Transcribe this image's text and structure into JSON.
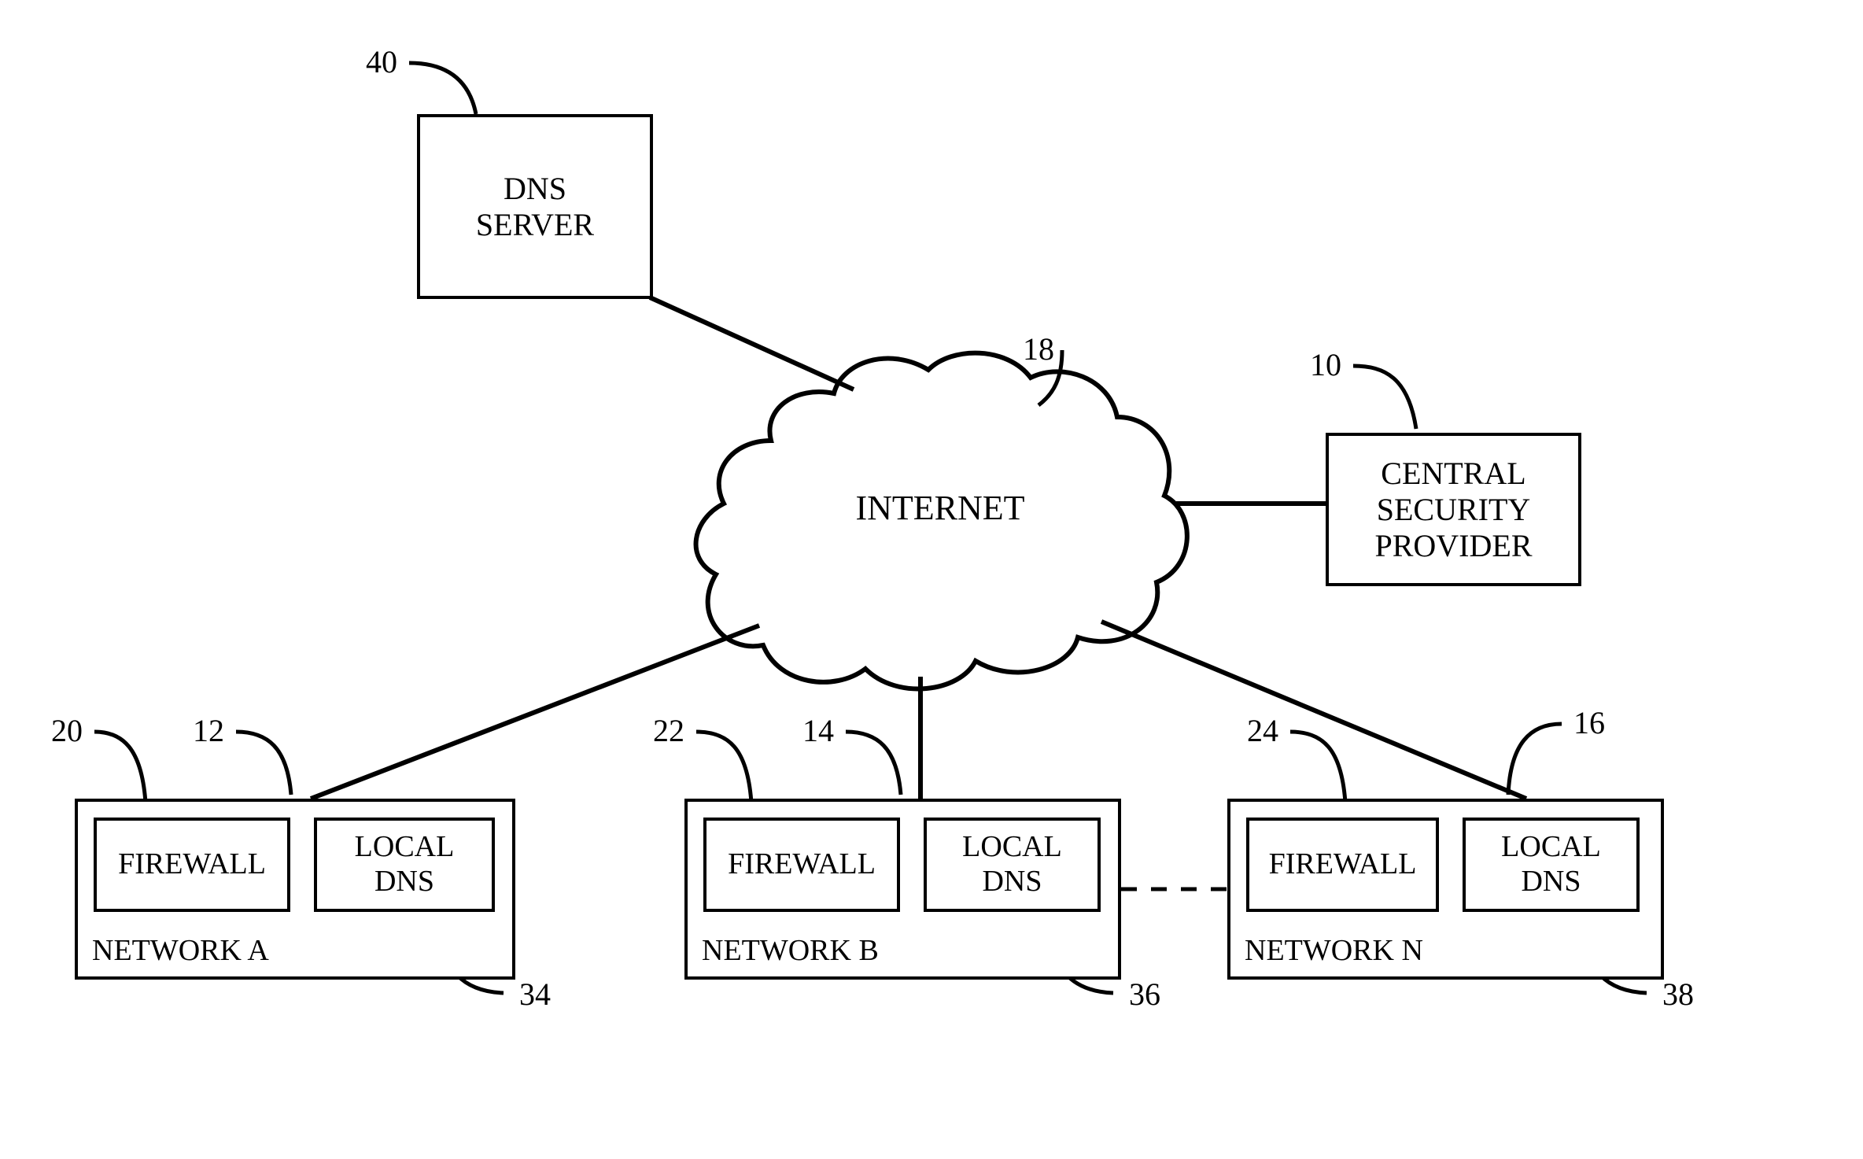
{
  "cloud": {
    "label": "INTERNET"
  },
  "dns_server": {
    "label": "DNS\nSERVER"
  },
  "csp": {
    "label": "CENTRAL\nSECURITY\nPROVIDER"
  },
  "networks": [
    {
      "name": "NETWORK A",
      "firewall": "FIREWALL",
      "local_dns": "LOCAL\nDNS"
    },
    {
      "name": "NETWORK B",
      "firewall": "FIREWALL",
      "local_dns": "LOCAL\nDNS"
    },
    {
      "name": "NETWORK N",
      "firewall": "FIREWALL",
      "local_dns": "LOCAL\nDNS"
    }
  ],
  "refs": {
    "r40": "40",
    "r18": "18",
    "r10": "10",
    "r20": "20",
    "r12": "12",
    "r22": "22",
    "r14": "14",
    "r24": "24",
    "r16": "16",
    "r34": "34",
    "r36": "36",
    "r38": "38"
  }
}
